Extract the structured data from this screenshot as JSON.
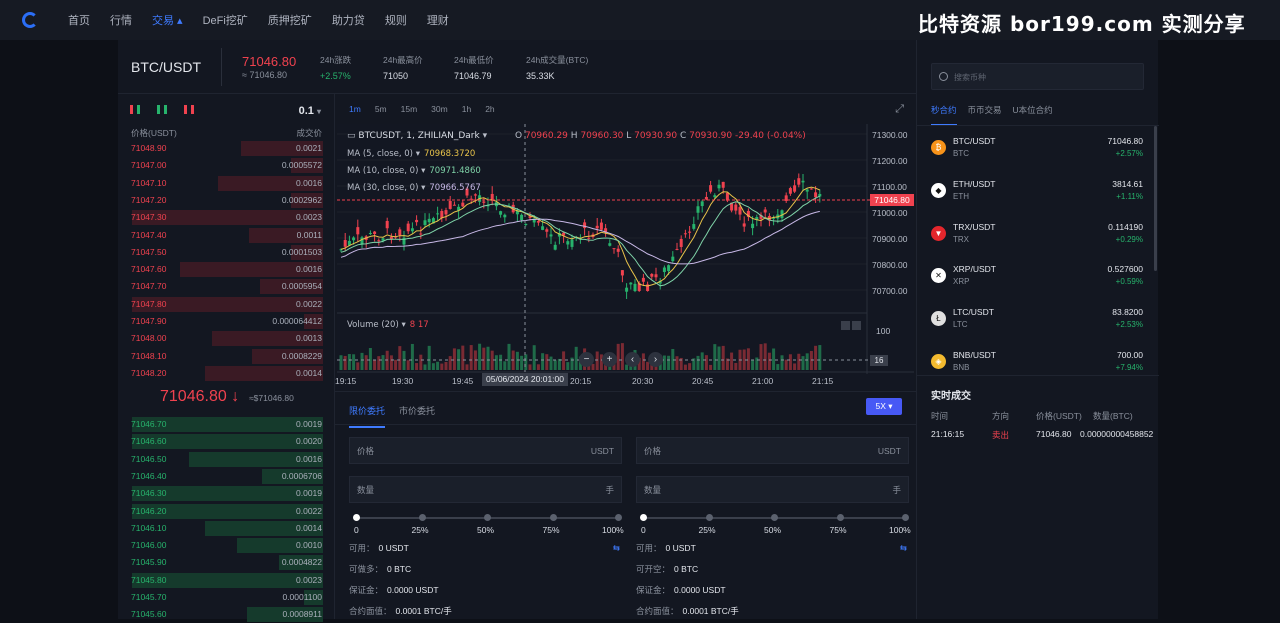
{
  "nav": {
    "items": [
      "首页",
      "行情",
      "交易",
      "DeFi挖矿",
      "质押挖矿",
      "助力贷",
      "规则",
      "理财"
    ],
    "active_index": 2
  },
  "watermark": "比特资源 bor199.com 实测分享",
  "ticker": {
    "pair": "BTC/USDT",
    "price": "71046.80",
    "price_approx": "≈ 71046.80",
    "change_label": "24h涨跌",
    "change_value": "+2.57%",
    "high_label": "24h最高价",
    "high_value": "71050",
    "low_label": "24h最低价",
    "low_value": "71046.79",
    "vol_label": "24h成交量(BTC)",
    "vol_value": "35.33K"
  },
  "orderbook": {
    "precision": "0.1",
    "header_price": "价格(USDT)",
    "header_qty": "成交价",
    "asks": [
      {
        "price": "71048.90",
        "qty": "0.0021",
        "depth": 0.43
      },
      {
        "price": "71047.00",
        "qty": "0.0005572",
        "depth": 0.17
      },
      {
        "price": "71047.10",
        "qty": "0.0016",
        "depth": 0.55
      },
      {
        "price": "71047.20",
        "qty": "0.0002962",
        "depth": 0.17
      },
      {
        "price": "71047.30",
        "qty": "0.0023",
        "depth": 1.0
      },
      {
        "price": "71047.40",
        "qty": "0.0011",
        "depth": 0.39
      },
      {
        "price": "71047.50",
        "qty": "0.0001503",
        "depth": 0.17
      },
      {
        "price": "71047.60",
        "qty": "0.0016",
        "depth": 0.75
      },
      {
        "price": "71047.70",
        "qty": "0.0005954",
        "depth": 0.33
      },
      {
        "price": "71047.80",
        "qty": "0.0022",
        "depth": 1.0
      },
      {
        "price": "71047.90",
        "qty": "0.000064412",
        "depth": 0.1
      },
      {
        "price": "71048.00",
        "qty": "0.0013",
        "depth": 0.58
      },
      {
        "price": "71048.10",
        "qty": "0.0008229",
        "depth": 0.37
      },
      {
        "price": "71048.20",
        "qty": "0.0014",
        "depth": 0.62
      }
    ],
    "mid_price": "71046.80",
    "mid_arrow": "↓",
    "mid_sub": "≈$71046.80",
    "bids": [
      {
        "price": "71046.70",
        "qty": "0.0019",
        "depth": 1.0
      },
      {
        "price": "71046.60",
        "qty": "0.0020",
        "depth": 1.0
      },
      {
        "price": "71046.50",
        "qty": "0.0016",
        "depth": 0.7
      },
      {
        "price": "71046.40",
        "qty": "0.0006706",
        "depth": 0.32
      },
      {
        "price": "71046.30",
        "qty": "0.0019",
        "depth": 1.0
      },
      {
        "price": "71046.20",
        "qty": "0.0022",
        "depth": 1.0
      },
      {
        "price": "71046.10",
        "qty": "0.0014",
        "depth": 0.62
      },
      {
        "price": "71046.00",
        "qty": "0.0010",
        "depth": 0.45
      },
      {
        "price": "71045.90",
        "qty": "0.0004822",
        "depth": 0.23
      },
      {
        "price": "71045.80",
        "qty": "0.0023",
        "depth": 1.0
      },
      {
        "price": "71045.70",
        "qty": "0.0001100",
        "depth": 0.1
      },
      {
        "price": "71045.60",
        "qty": "0.0008911",
        "depth": 0.4
      }
    ]
  },
  "chart": {
    "timeframes": [
      "1m",
      "5m",
      "15m",
      "30m",
      "1h",
      "2h"
    ],
    "active_tf": 0,
    "symbol": "BTCUSDT, 1, ZHILIAN_Dark",
    "ohlc": {
      "o": "70960.29",
      "h": "70960.30",
      "l": "70930.90",
      "c": "70930.90",
      "chg": "-29.40 (-0.04%)"
    },
    "ma5_label": "MA (5, close, 0)",
    "ma5": "70968.3720",
    "ma5_color": "#e8c34a",
    "ma10_label": "MA (10, close, 0)",
    "ma10": "70971.4860",
    "ma10_color": "#7fd3a8",
    "ma30_label": "MA (30, close, 0)",
    "ma30": "70966.5767",
    "ma30_color": "#c7b8e6",
    "volume_label": "Volume (20)",
    "volume_vals": "8  17",
    "y_ticks": [
      "71300.00",
      "71200.00",
      "71100.00",
      "71000.00",
      "70900.00",
      "70800.00",
      "70700.00"
    ],
    "price_tag": "71046.80",
    "vol_axis": "100",
    "vol_tag": "16",
    "x_ticks": [
      "19:15",
      "19:30",
      "19:45",
      "20:15",
      "20:30",
      "20:45",
      "21:00",
      "21:15"
    ],
    "crosshair_label": "05/06/2024  20:01:00",
    "nav_buttons": [
      "−",
      "+",
      "‹",
      "›"
    ]
  },
  "form": {
    "tabs": [
      "限价委托",
      "市价委托"
    ],
    "active_tab": 0,
    "leverage": "5X",
    "price_label": "价格",
    "price_unit": "USDT",
    "qty_label": "数量",
    "qty_unit": "手",
    "ticks": [
      "0",
      "25%",
      "50%",
      "75%",
      "100%"
    ],
    "left": {
      "avail_label": "可用",
      "avail": "0 USDT",
      "can_label": "可做多",
      "can": "0 BTC",
      "margin_label": "保证金",
      "margin": "0.0000 USDT",
      "face_label": "合约面值",
      "face": "0.0001 BTC/手"
    },
    "right": {
      "avail_label": "可用",
      "avail": "0 USDT",
      "can_label": "可开空",
      "can": "0 BTC",
      "margin_label": "保证金",
      "margin": "0.0000 USDT",
      "face_label": "合约面值",
      "face": "0.0001 BTC/手"
    },
    "swap_icon": "⇆"
  },
  "market": {
    "search_placeholder": "搜索币种",
    "tabs": [
      "秒合约",
      "币币交易",
      "U本位合约"
    ],
    "active_tab": 0,
    "coins": [
      {
        "pair": "BTC/USDT",
        "base": "BTC",
        "price": "71046.80",
        "change": "+2.57%",
        "color": "#f7931a",
        "glyph": "₿"
      },
      {
        "pair": "ETH/USDT",
        "base": "ETH",
        "price": "3814.61",
        "change": "+1.11%",
        "color": "#ffffff",
        "glyph": "◆"
      },
      {
        "pair": "TRX/USDT",
        "base": "TRX",
        "price": "0.114190",
        "change": "+0.29%",
        "color": "#e4262c",
        "glyph": "▼"
      },
      {
        "pair": "XRP/USDT",
        "base": "XRP",
        "price": "0.527600",
        "change": "+0.59%",
        "color": "#ffffff",
        "glyph": "✕"
      },
      {
        "pair": "LTC/USDT",
        "base": "LTC",
        "price": "83.8200",
        "change": "+2.53%",
        "color": "#e0e0e0",
        "glyph": "Ł"
      },
      {
        "pair": "BNB/USDT",
        "base": "BNB",
        "price": "700.00",
        "change": "+7.94%",
        "color": "#f3ba2f",
        "glyph": "◈"
      }
    ],
    "trades_title": "实时成交",
    "trades_headers": [
      "时间",
      "方向",
      "价格(USDT)",
      "数量(BTC)"
    ],
    "trades": [
      {
        "time": "21:16:15",
        "side": "卖出",
        "price": "71046.80",
        "qty": "0.00000000458852"
      }
    ]
  }
}
